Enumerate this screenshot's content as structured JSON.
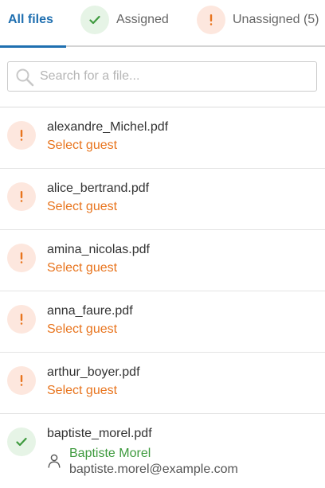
{
  "tabs": {
    "all": {
      "label": "All files"
    },
    "assigned": {
      "label": "Assigned",
      "icon": "check-icon"
    },
    "unassigned": {
      "label": "Unassigned (5)",
      "icon": "exclamation-icon"
    },
    "active": "all"
  },
  "search": {
    "placeholder": "Search for a file...",
    "value": ""
  },
  "files": [
    {
      "name": "alexandre_Michel.pdf",
      "status": "unassigned",
      "action_label": "Select guest"
    },
    {
      "name": "alice_bertrand.pdf",
      "status": "unassigned",
      "action_label": "Select guest"
    },
    {
      "name": "amina_nicolas.pdf",
      "status": "unassigned",
      "action_label": "Select guest"
    },
    {
      "name": "anna_faure.pdf",
      "status": "unassigned",
      "action_label": "Select guest"
    },
    {
      "name": "arthur_boyer.pdf",
      "status": "unassigned",
      "action_label": "Select guest"
    },
    {
      "name": "baptiste_morel.pdf",
      "status": "assigned",
      "guest_name": "Baptiste Morel",
      "guest_email": "baptiste.morel@example.com"
    }
  ],
  "colors": {
    "accent_blue": "#1f6fb0",
    "warning_orange": "#e8741d",
    "warning_bg": "#fde7de",
    "success_green": "#3e9a3e",
    "success_bg": "#e6f4e6"
  }
}
